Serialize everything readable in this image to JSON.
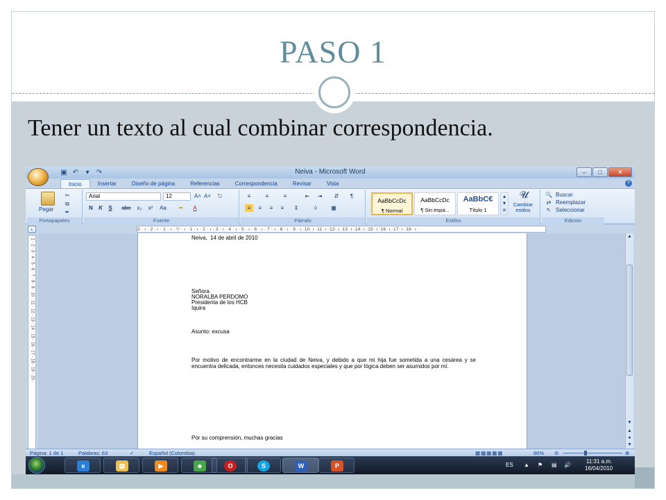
{
  "slide": {
    "title": "PASO 1",
    "subtitle": "Tener un texto al cual combinar correspondencia."
  },
  "word": {
    "window_title": "Neiva - Microsoft Word",
    "window_controls": [
      "–",
      "□",
      "✕"
    ],
    "tabs": [
      "Inicio",
      "Insertar",
      "Diseño de página",
      "Referencias",
      "Correspondencia",
      "Revisar",
      "Vista"
    ],
    "active_tab": "Inicio",
    "ribbon": {
      "clipboard": {
        "paste_label": "Pegar",
        "group_label": "Portapapeles"
      },
      "font": {
        "font_name": "Arial",
        "font_size": "12",
        "group_label": "Fuente",
        "buttons": [
          "N",
          "K",
          "S",
          "abe",
          "x₂",
          "x²",
          "Aa"
        ]
      },
      "paragraph": {
        "group_label": "Párrafo"
      },
      "styles": {
        "group_label": "Estilos",
        "items": [
          {
            "sample": "AaBbCcDc",
            "name": "¶ Normal"
          },
          {
            "sample": "AaBbCcDc",
            "name": "¶ Sin espa..."
          },
          {
            "sample": "AaBbC€",
            "name": "Título 1"
          }
        ],
        "change_styles": "Cambiar estilos"
      },
      "editing": {
        "group_label": "Edición",
        "items": [
          "Buscar",
          "Reemplazar",
          "Seleccionar"
        ]
      }
    },
    "ruler_text": "3 · ı · 2 · ı · 1 · ı · ▽ · ı · 1 · ı · 2 · ı · 3 · ı · 4 · ı · 5 · ı · 6 · ı · 7 · ı · 8 · ı · 9 · ı ·10· ı ·11· ı ·12· ı ·13· ı ·14· ı ·15· ı ·16· ı ·17· ı ·18· ı ·",
    "vruler_text": "· 1 · 2 · 3 · 4 · 5 · 6 · 7 · 8 · 9 · 10 · 11 · 12 · 13 · 14 · 15 · 16 · 17 · 18 · 19 · 20 ·",
    "document": {
      "date_line": "Neiva,  14 de abril de 2010",
      "recipient": [
        "Señora",
        "NORALBA PERDOMO",
        "Presidenta de los HCB",
        "Iquira"
      ],
      "subject": "Asunto: excusa",
      "body": "Por motivo de encontrarme en  la ciudad de Neiva, y debido a que mi hija fue sometida a una cesárea y se encuentra  delicada, entonces necesita cuidados especiales y que por lógica deben ser asumidos por mí.",
      "closing": "Por su comprensión, muchas gracias"
    },
    "status": {
      "page": "Página: 1 de 1",
      "words": "Palabras: 63",
      "language": "Español (Colombia)",
      "zoom": "80%"
    },
    "taskbar": {
      "language": "ES",
      "time": "11:31 a.m.",
      "date": "16/04/2010"
    }
  },
  "colors": {
    "title": "#5f8c9b",
    "slide_body": "#c9d2d8",
    "ribbon": "#dce8f5",
    "taskbar": "#1d2a3d"
  }
}
